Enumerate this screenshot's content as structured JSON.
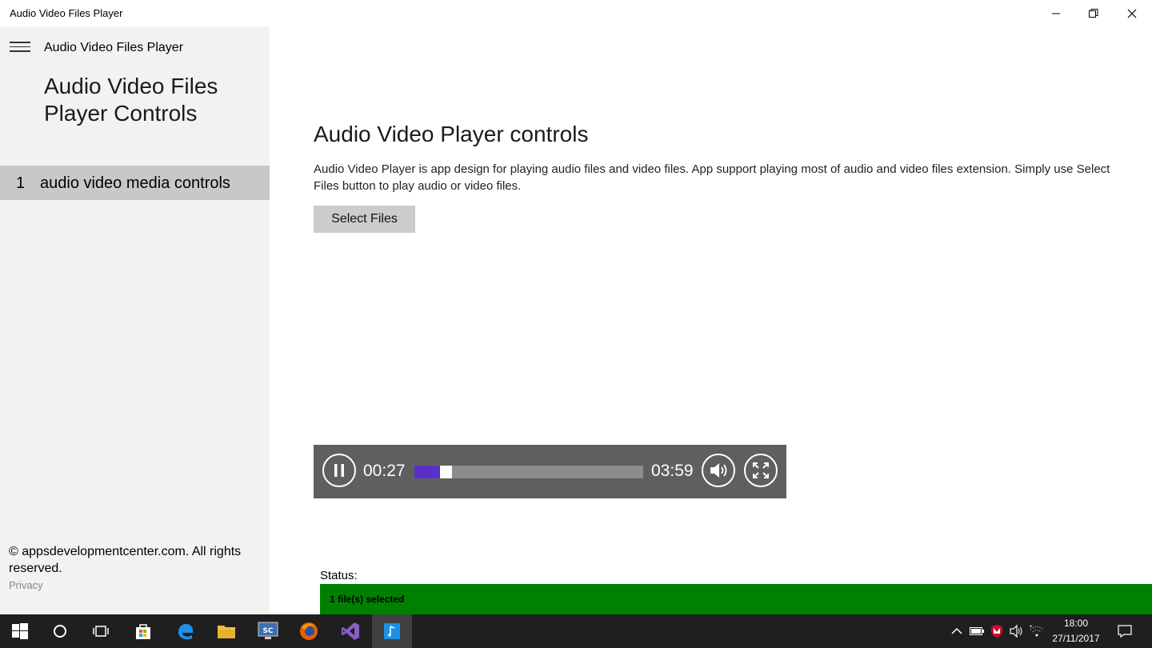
{
  "window": {
    "title": "Audio Video Files Player",
    "controls": [
      "minimize-icon",
      "restore-icon",
      "close-icon"
    ]
  },
  "sidebar": {
    "menu_icon": "hamburger-icon",
    "app_name": "Audio Video Files Player",
    "heading": "Audio Video Files Player Controls",
    "items": [
      {
        "number": "1",
        "label": "audio video media controls",
        "selected": true
      }
    ],
    "copyright": "© appsdevelopmentcenter.com. All rights reserved.",
    "privacy": "Privacy"
  },
  "main": {
    "title": "Audio Video Player controls",
    "description": "Audio Video Player is app design for playing audio files and video files. App support playing most of audio and video files extension. Simply use Select Files button to play audio or video files.",
    "select_button": "Select Files",
    "player": {
      "current_time": "00:27",
      "total_time": "03:59",
      "progress_fraction": 0.113,
      "progress_color": "#5b2fc9",
      "icons": [
        "pause-icon",
        "volume-icon",
        "fullscreen-icon"
      ]
    },
    "status_label": "Status:",
    "status_message": "1 file(s) selected",
    "status_color": "#008000"
  },
  "taskbar": {
    "icons": [
      "windows-start-icon",
      "cortana-icon",
      "task-view-icon",
      "store-icon",
      "edge-icon",
      "file-explorer-icon",
      "screen-capture-icon",
      "firefox-icon",
      "visual-studio-icon",
      "audio-player-app-icon"
    ],
    "tray_icons": [
      "chevron-up-icon",
      "battery-icon",
      "security-shield-icon",
      "speaker-icon",
      "wifi-icon",
      "notifications-icon"
    ],
    "time": "18:00",
    "date": "27/11/2017"
  }
}
